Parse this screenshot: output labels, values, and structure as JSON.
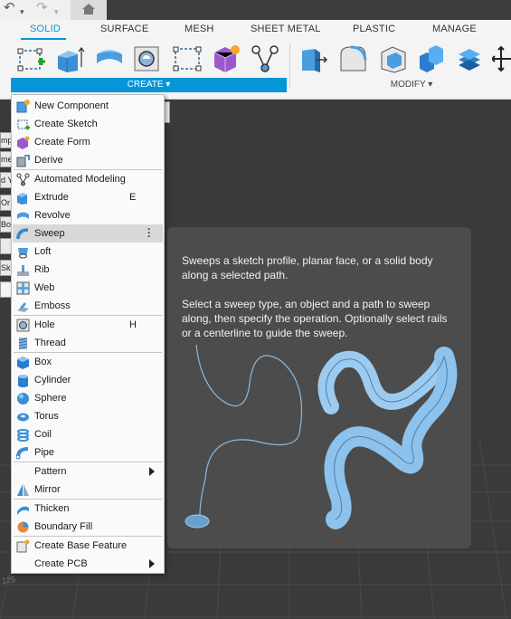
{
  "quick_access": {
    "undo_icon": "undo-icon",
    "redo_icon": "redo-icon",
    "home_icon": "home-icon"
  },
  "tabs": [
    {
      "label": "SOLID",
      "active": true
    },
    {
      "label": "SURFACE",
      "active": false
    },
    {
      "label": "MESH",
      "active": false
    },
    {
      "label": "SHEET METAL",
      "active": false
    },
    {
      "label": "PLASTIC",
      "active": false
    },
    {
      "label": "MANAGE",
      "active": false
    }
  ],
  "ribbon": {
    "create_label": "CREATE ▾",
    "modify_label": "MODIFY ▾",
    "accent": "#0696d7"
  },
  "left_stubs": [
    "mp",
    "me",
    "d Y",
    "Or",
    "Bo",
    "",
    "Sk",
    ""
  ],
  "menu": {
    "items": [
      {
        "label": "New Component",
        "icon": "new-component-icon",
        "shortcut": "",
        "submenu": false
      },
      {
        "label": "Create Sketch",
        "icon": "create-sketch-icon",
        "shortcut": "",
        "submenu": false
      },
      {
        "label": "Create Form",
        "icon": "create-form-icon",
        "shortcut": "",
        "submenu": false
      },
      {
        "label": "Derive",
        "icon": "derive-icon",
        "shortcut": "",
        "submenu": false
      },
      {
        "label": "Automated Modeling",
        "icon": "automated-modeling-icon",
        "shortcut": "",
        "submenu": false
      },
      {
        "label": "Extrude",
        "icon": "extrude-icon",
        "shortcut": "E",
        "submenu": false
      },
      {
        "label": "Revolve",
        "icon": "revolve-icon",
        "shortcut": "",
        "submenu": false
      },
      {
        "label": "Sweep",
        "icon": "sweep-icon",
        "shortcut": "",
        "submenu": false,
        "highlighted": true
      },
      {
        "label": "Loft",
        "icon": "loft-icon",
        "shortcut": "",
        "submenu": false
      },
      {
        "label": "Rib",
        "icon": "rib-icon",
        "shortcut": "",
        "submenu": false
      },
      {
        "label": "Web",
        "icon": "web-icon",
        "shortcut": "",
        "submenu": false
      },
      {
        "label": "Emboss",
        "icon": "emboss-icon",
        "shortcut": "",
        "submenu": false
      },
      {
        "label": "Hole",
        "icon": "hole-icon",
        "shortcut": "H",
        "submenu": false
      },
      {
        "label": "Thread",
        "icon": "thread-icon",
        "shortcut": "",
        "submenu": false
      },
      {
        "label": "Box",
        "icon": "box-icon",
        "shortcut": "",
        "submenu": false
      },
      {
        "label": "Cylinder",
        "icon": "cylinder-icon",
        "shortcut": "",
        "submenu": false
      },
      {
        "label": "Sphere",
        "icon": "sphere-icon",
        "shortcut": "",
        "submenu": false
      },
      {
        "label": "Torus",
        "icon": "torus-icon",
        "shortcut": "",
        "submenu": false
      },
      {
        "label": "Coil",
        "icon": "coil-icon",
        "shortcut": "",
        "submenu": false
      },
      {
        "label": "Pipe",
        "icon": "pipe-icon",
        "shortcut": "",
        "submenu": false
      },
      {
        "label": "Pattern",
        "icon": "",
        "shortcut": "",
        "submenu": true
      },
      {
        "label": "Mirror",
        "icon": "mirror-icon",
        "shortcut": "",
        "submenu": false
      },
      {
        "label": "Thicken",
        "icon": "thicken-icon",
        "shortcut": "",
        "submenu": false
      },
      {
        "label": "Boundary Fill",
        "icon": "boundary-fill-icon",
        "shortcut": "",
        "submenu": false
      },
      {
        "label": "Create Base Feature",
        "icon": "create-base-feature-icon",
        "shortcut": "",
        "submenu": false
      },
      {
        "label": "Create PCB",
        "icon": "",
        "shortcut": "",
        "submenu": true
      }
    ]
  },
  "tooltip": {
    "line1": "Sweeps a sketch profile, planar face, or a solid body along a selected path.",
    "line2": "Select a sweep type, an object and a path to sweep along, then specify the operation. Optionally select rails or a centerline to guide the sweep."
  },
  "viewport": {
    "grid_label": "125"
  }
}
